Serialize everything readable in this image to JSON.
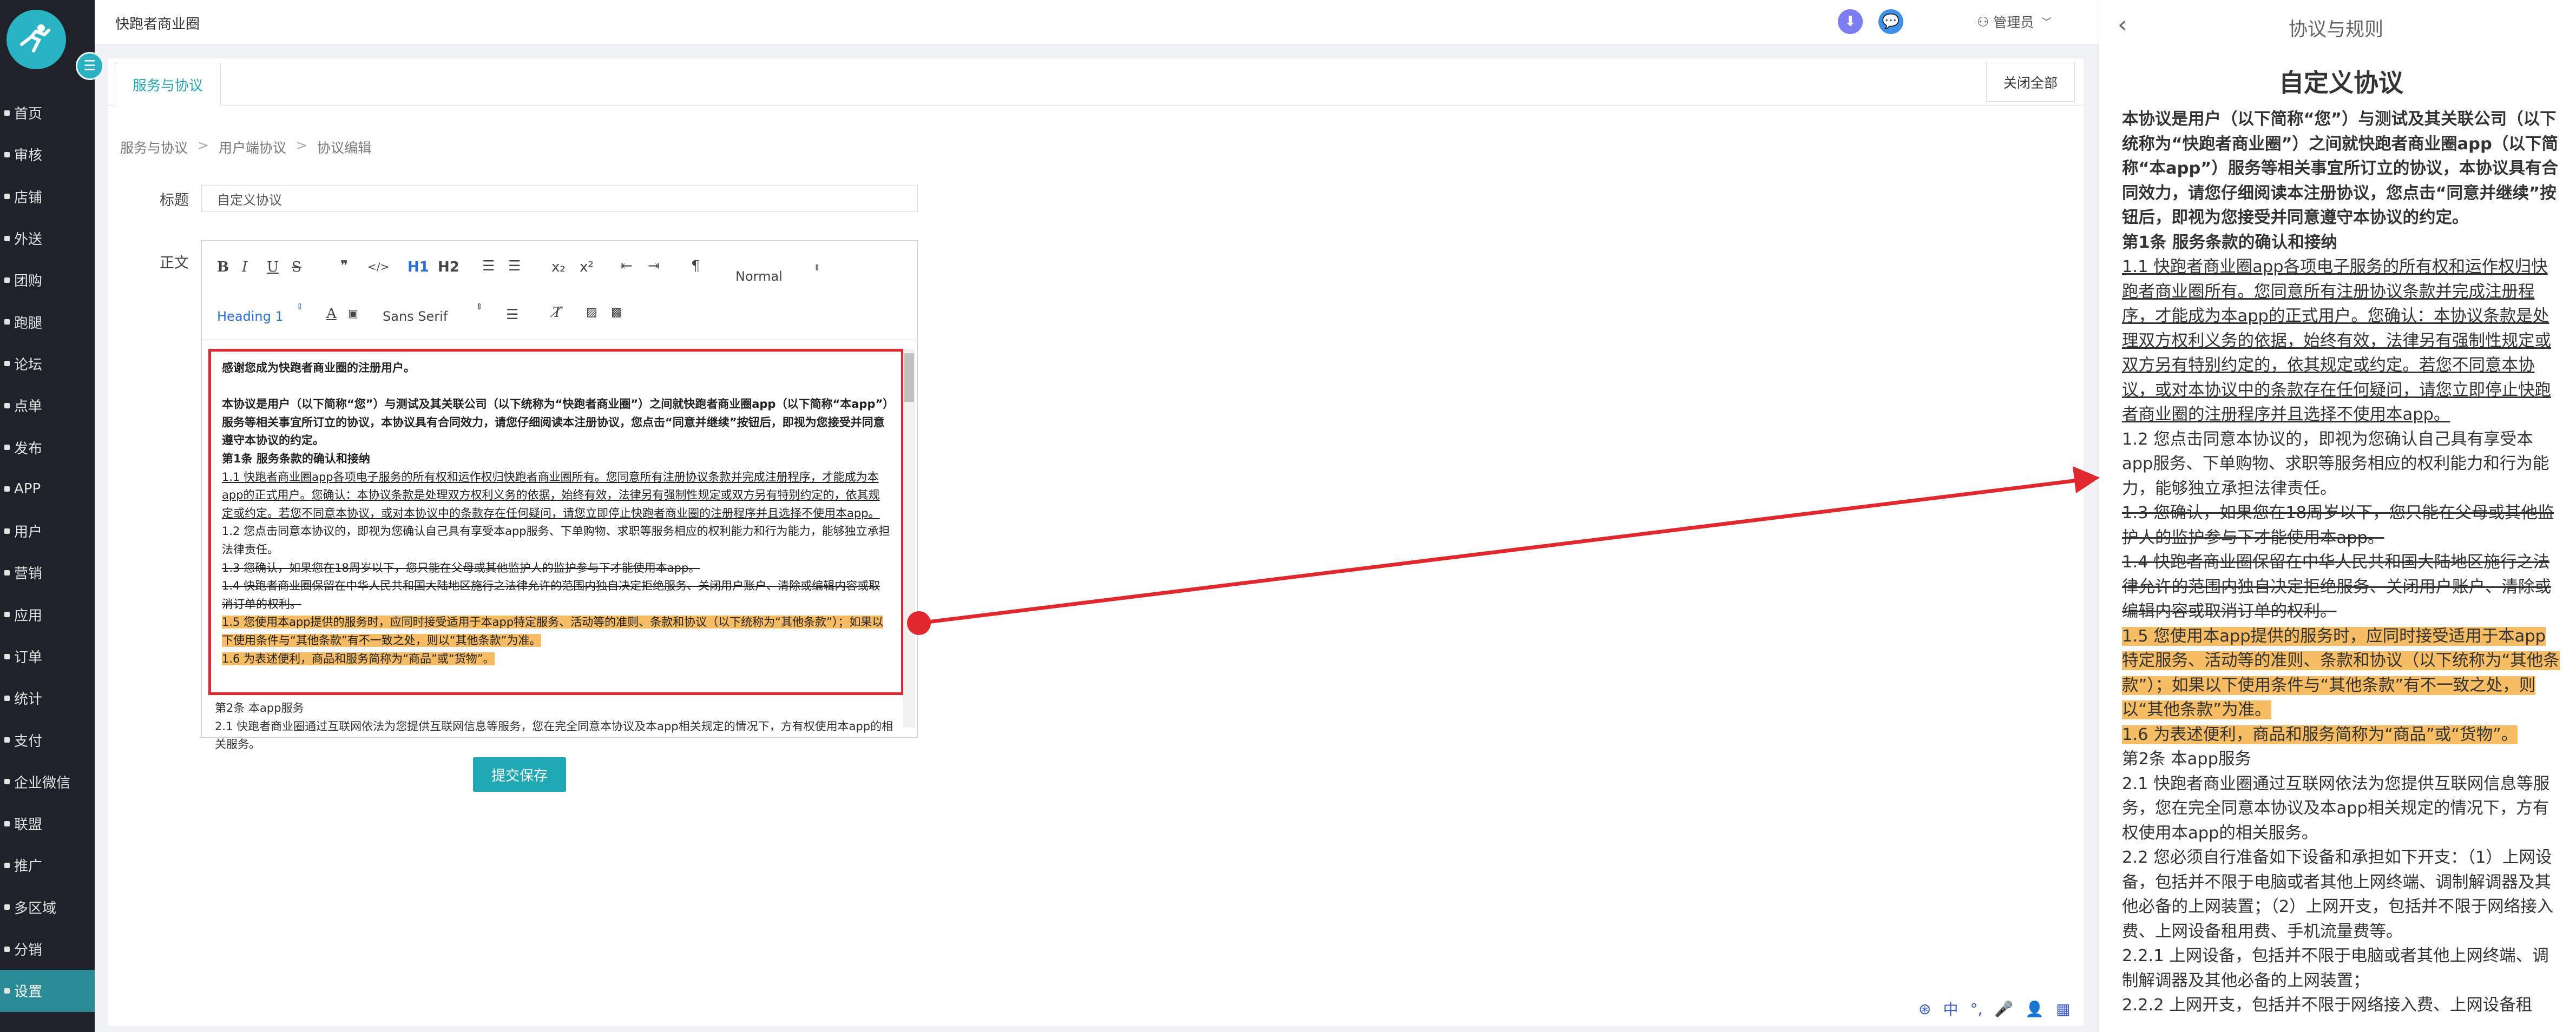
{
  "app": {
    "title": "快跑者商业圈",
    "admin": "管理员"
  },
  "sidebar": {
    "items": [
      {
        "label": "首页"
      },
      {
        "label": "审核"
      },
      {
        "label": "店铺"
      },
      {
        "label": "外送"
      },
      {
        "label": "团购"
      },
      {
        "label": "跑腿"
      },
      {
        "label": "论坛"
      },
      {
        "label": "点单"
      },
      {
        "label": "发布"
      },
      {
        "label": "APP"
      },
      {
        "label": "用户"
      },
      {
        "label": "营销"
      },
      {
        "label": "应用"
      },
      {
        "label": "订单"
      },
      {
        "label": "统计"
      },
      {
        "label": "支付"
      },
      {
        "label": "企业微信"
      },
      {
        "label": "联盟"
      },
      {
        "label": "推广"
      },
      {
        "label": "多区域"
      },
      {
        "label": "分销"
      },
      {
        "label": "设置"
      }
    ]
  },
  "tabs": {
    "active": "服务与协议",
    "close_all": "关闭全部"
  },
  "breadcrumb": [
    "服务与协议",
    "用户端协议",
    "协议编辑"
  ],
  "form": {
    "title_label": "标题",
    "title_value": "自定义协议",
    "body_label": "正文",
    "submit": "提交保存"
  },
  "editor_toolbar": {
    "bold": "B",
    "italic": "I",
    "underline": "U",
    "strike": "S",
    "quote": "❞",
    "code": "</>",
    "h1": "H1",
    "h2": "H2",
    "sub": "x₂",
    "sup": "x²",
    "normal": "Normal",
    "heading": "Heading 1",
    "font": "Sans Serif"
  },
  "doc": {
    "greeting": "感谢您成为快跑者商业圈的注册用户。",
    "intro": "本协议是用户（以下简称“您”）与测试及其关联公司（以下统称为“快跑者商业圈”）之间就快跑者商业圈app（以下简称“本app”）服务等相关事宜所订立的协议，本协议具有合同效力，请您仔细阅读本注册协议，您点击“同意并继续”按钮后，即视为您接受并同意遵守本协议的约定。",
    "s1": "第1条 服务条款的确认和接纳",
    "p11": "1.1 快跑者商业圈app各项电子服务的所有权和运作权归快跑者商业圈所有。您同意所有注册协议条款并完成注册程序，才能成为本app的正式用户。您确认：本协议条款是处理双方权利义务的依据，始终有效，法律另有强制性规定或双方另有特别约定的，依其规定或约定。若您不同意本协议，或对本协议中的条款存在任何疑问，请您立即停止快跑者商业圈的注册程序并且选择不使用本app。",
    "p12": "1.2 您点击同意本协议的，即视为您确认自己具有享受本app服务、下单购物、求职等服务相应的权利能力和行为能力，能够独立承担法律责任。",
    "p13": "1.3 您确认，如果您在18周岁以下，您只能在父母或其他监护人的监护参与下才能使用本app。",
    "p14": "1.4 快跑者商业圈保留在中华人民共和国大陆地区施行之法律允许的范围内独自决定拒绝服务、关闭用户账户、清除或编辑内容或取消订单的权利。",
    "p15": "1.5 您使用本app提供的服务时，应同时接受适用于本app特定服务、活动等的准则、条款和协议（以下统称为“其他条款”）；如果以下使用条件与“其他条款”有不一致之处，则以“其他条款”为准。",
    "p16": "1.6 为表述便利，商品和服务简称为“商品”或“货物”。",
    "s2": "第2条 本app服务",
    "p21": "2.1 快跑者商业圈通过互联网依法为您提供互联网信息等服务，您在完全同意本协议及本app相关规定的情况下，方有权使用本app的相关服务。",
    "p22": "2.2 您必须自行准备如下设备和承担如下开支：（1）上网设备，包括并不限于电脑或者其他上网终端、调制解调器及其他必备的上网装置；（2）上网开支，包括并不限于网络接入费、上网设备租用费、手机流量费等。",
    "p221": "2.2.1 上网设备，包括并不限于电脑或者其他上网终端、调制解调器及其他必备的上网装置；",
    "p222": "2.2.2 上网开支，包括并不限于网络接入费、上网设备租"
  },
  "panel": {
    "title": "协议与规则",
    "doc_title": "自定义协议"
  },
  "colors": {
    "accent": "#20a8b5",
    "sidebar": "#20222a",
    "highlight": "#f6bd64",
    "annotation": "#e0282e"
  }
}
